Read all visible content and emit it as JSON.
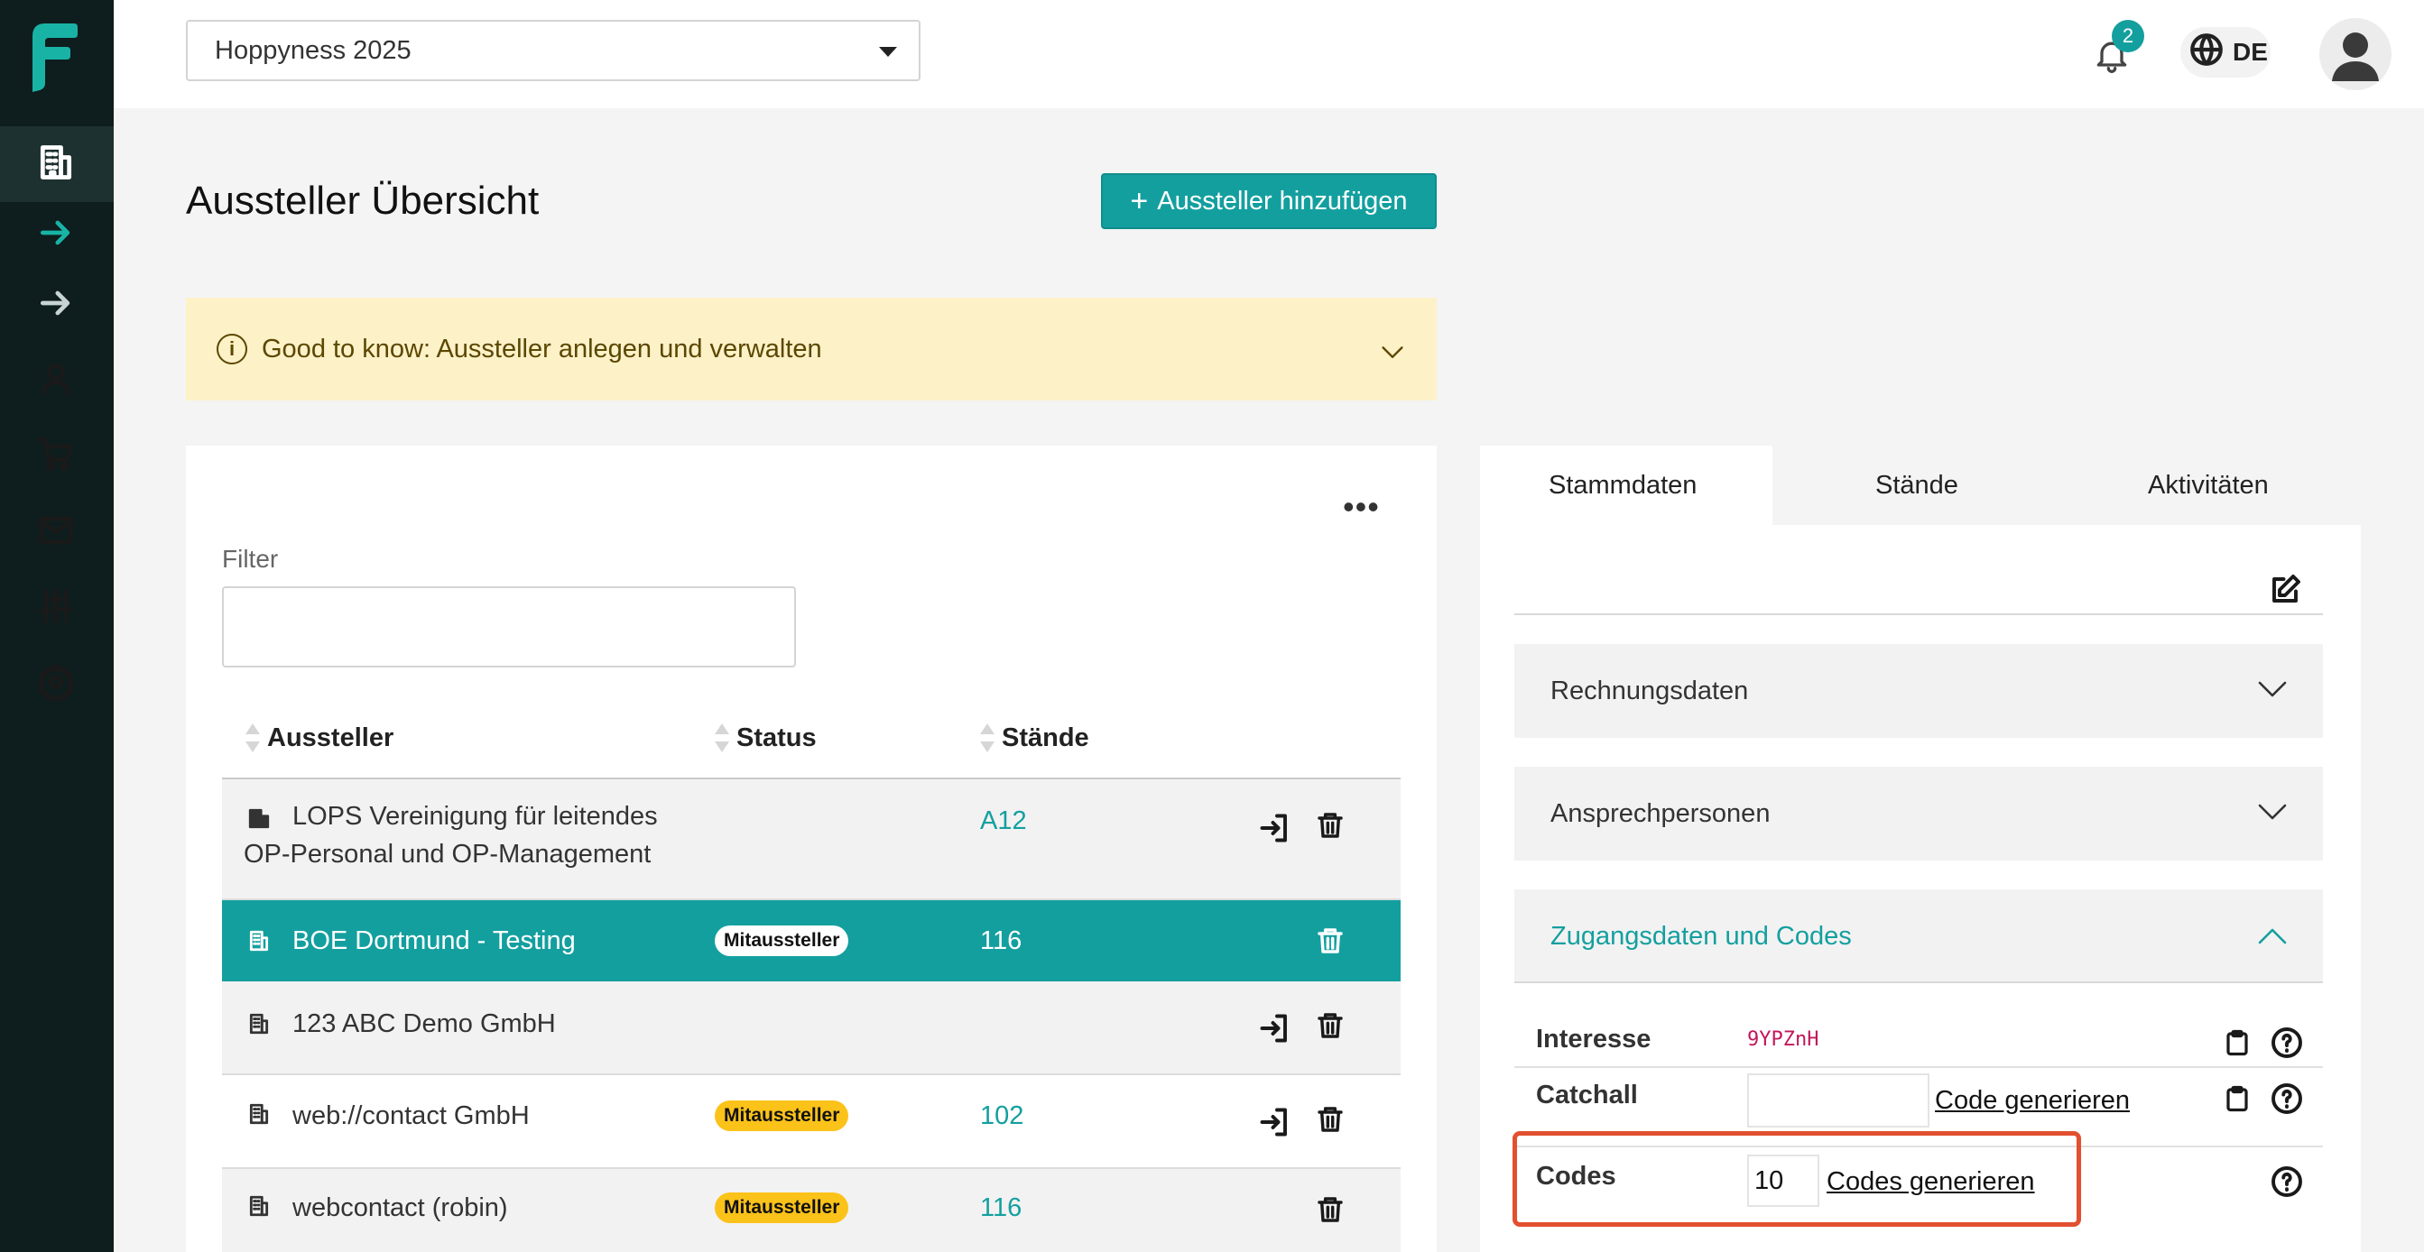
{
  "header": {
    "event_select": "Hoppyness 2025",
    "notification_count": "2",
    "language": "DE"
  },
  "page": {
    "title": "Aussteller Übersicht",
    "add_button": "Aussteller hinzufügen",
    "info_text": "Good to know: Aussteller anlegen und verwalten"
  },
  "filter": {
    "label": "Filter",
    "value": ""
  },
  "table": {
    "headers": [
      "Aussteller",
      "Status",
      "Stände"
    ],
    "rows": [
      {
        "name_line1": "LOPS Vereinigung für leitendes",
        "name_line2": "OP-Personal und OP-Management",
        "status": "",
        "stand": "A12",
        "selected": false
      },
      {
        "name_line1": "BOE Dortmund - Testing",
        "status": "Mitaussteller",
        "stand": "116",
        "selected": true
      },
      {
        "name_line1": "123 ABC Demo GmbH",
        "status": "",
        "stand": "",
        "selected": false
      },
      {
        "name_line1": "web://contact GmbH",
        "status": "Mitaussteller",
        "stand": "102",
        "selected": false
      },
      {
        "name_line1": "webcontact (robin)",
        "status": "Mitaussteller",
        "stand": "116",
        "selected": false
      }
    ]
  },
  "detail": {
    "tabs": [
      "Stammdaten",
      "Stände",
      "Aktivitäten"
    ],
    "active_tab": "Stammdaten",
    "sections": [
      "Rechnungsdaten",
      "Ansprechpersonen",
      "Zugangsdaten und Codes"
    ],
    "codes": {
      "interesse_label": "Interesse",
      "interesse_value": "9YPZnH",
      "catchall_label": "Catchall",
      "catchall_value": "",
      "catchall_link": "Code generieren",
      "codes_label": "Codes",
      "codes_count": "10",
      "codes_link": "Codes generieren"
    }
  },
  "colors": {
    "accent": "#149f9f",
    "sidebar": "#0e1d1d",
    "highlight": "#e2502f",
    "badge_yellow": "#fbc21a"
  }
}
